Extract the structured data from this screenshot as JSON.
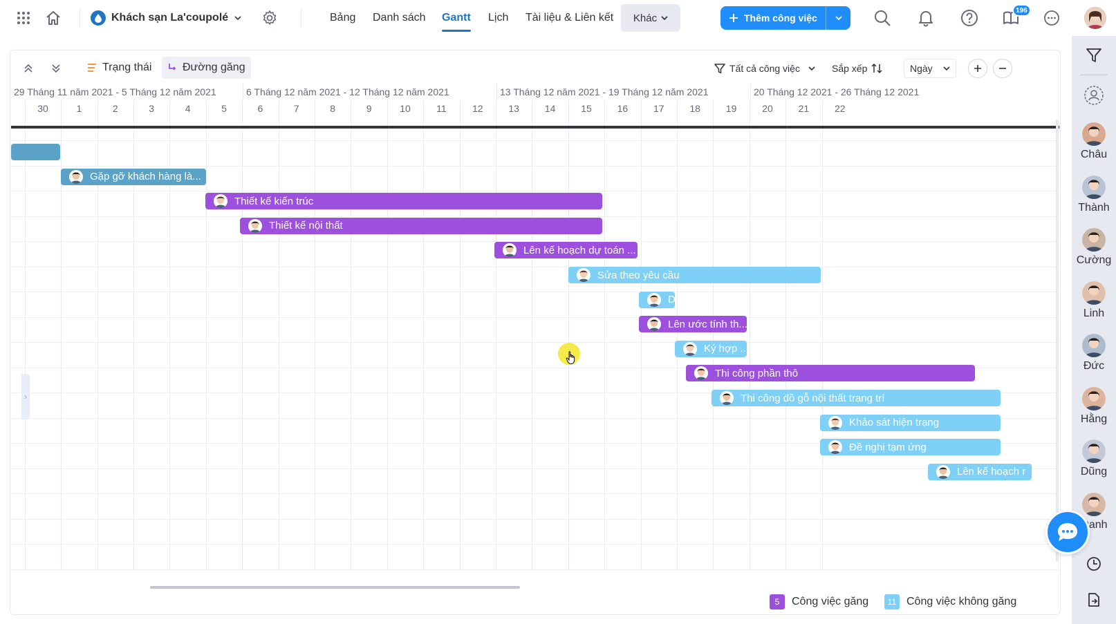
{
  "topbar": {
    "project_name": "Khách sạn La'coupolé",
    "tabs": [
      {
        "label": "Bảng"
      },
      {
        "label": "Danh sách"
      },
      {
        "label": "Gantt"
      },
      {
        "label": "Lịch"
      },
      {
        "label": "Tài liệu & Liên kết"
      }
    ],
    "more_label": "Khác",
    "add_task_label": "Thêm công việc",
    "notification_count": "196",
    "accent_color": "#1f8efa"
  },
  "toolbar": {
    "status_label": "Trạng thái",
    "critical_path_label": "Đường găng",
    "filter_label": "Tất cả công việc",
    "sort_label": "Sắp xếp",
    "scale_value": "Ngày"
  },
  "timeline": {
    "weeks": [
      "29 Tháng 11 năm 2021 - 5 Tháng 12 năm 2021",
      "6 Tháng 12 năm 2021 - 12 Tháng 12 năm 2021",
      "13 Tháng 12 năm 2021 - 19 Tháng 12 năm 2021",
      "20 Tháng 12 2021 - 26 Tháng 12 2021"
    ],
    "days": [
      "30",
      "1",
      "2",
      "3",
      "4",
      "5",
      "6",
      "7",
      "8",
      "9",
      "10",
      "11",
      "12",
      "13",
      "14",
      "15",
      "16",
      "17",
      "18",
      "19",
      "20",
      "21",
      "22"
    ]
  },
  "tasks": [
    {
      "label": "",
      "type": "non-critical"
    },
    {
      "label": "Gặp gỡ khách hàng là...",
      "type": "non-critical"
    },
    {
      "label": "Thiết kế kiến trúc",
      "type": "critical"
    },
    {
      "label": "Thiết kế nội thất",
      "type": "critical"
    },
    {
      "label": "Lên kế hoạch dự toán ...",
      "type": "critical"
    },
    {
      "label": "Sửa theo yêu cầu",
      "type": "non-critical"
    },
    {
      "label": "D",
      "type": "non-critical"
    },
    {
      "label": "Lên ước tính th...",
      "type": "critical"
    },
    {
      "label": "Ký hợp ...",
      "type": "non-critical"
    },
    {
      "label": "Thi công phần thô",
      "type": "critical"
    },
    {
      "label": "Thi công đồ gỗ nội thất trang trí",
      "type": "non-critical"
    },
    {
      "label": "Khảo sát hiện trạng",
      "type": "non-critical"
    },
    {
      "label": "Đề nghị tạm ứng",
      "type": "non-critical"
    },
    {
      "label": "Lên kế hoạch r",
      "type": "non-critical"
    }
  ],
  "legend": {
    "critical_count": "5",
    "critical_label": "Công việc găng",
    "critical_color": "#9d50dd",
    "noncritical_count": "11",
    "noncritical_label": "Công việc không găng",
    "noncritical_color": "#7ed0f7"
  },
  "members": [
    {
      "name": "Châu"
    },
    {
      "name": "Thành"
    },
    {
      "name": "Cường"
    },
    {
      "name": "Linh"
    },
    {
      "name": "Đức"
    },
    {
      "name": "Hằng"
    },
    {
      "name": "Dũng"
    },
    {
      "name": "Oanh"
    }
  ]
}
